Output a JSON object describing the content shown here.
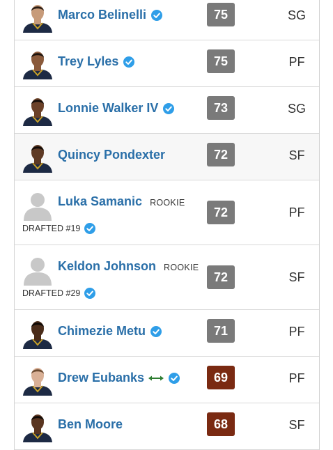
{
  "colors": {
    "name_link": "#2a6fa8",
    "rating_gray": "#7a7a7a",
    "rating_brown": "#7a2a12",
    "verified": "#2f9ee8",
    "trade_arrow": "#2e7d32"
  },
  "players": [
    {
      "name": "Marco Belinelli",
      "rating": "75",
      "position": "SG",
      "verified": true,
      "rookie": false,
      "skin": "#c79b7a",
      "hair": "#2b1d14"
    },
    {
      "name": "Trey Lyles",
      "rating": "75",
      "position": "PF",
      "verified": true,
      "rookie": false,
      "skin": "#8a5a3b",
      "hair": "#1c120c"
    },
    {
      "name": "Lonnie Walker IV",
      "rating": "73",
      "position": "SG",
      "verified": true,
      "rookie": false,
      "skin": "#6b4128",
      "hair": "#120c08"
    },
    {
      "name": "Quincy Pondexter",
      "rating": "72",
      "position": "SF",
      "verified": false,
      "rookie": false,
      "skin": "#5e3a24",
      "hair": "#100a06"
    },
    {
      "name": "Luka Samanic",
      "rating": "72",
      "position": "PF",
      "verified": false,
      "rookie": true,
      "rookie_label": "ROOKIE",
      "drafted": "DRAFTED #19"
    },
    {
      "name": "Keldon Johnson",
      "rating": "72",
      "position": "SF",
      "verified": false,
      "rookie": true,
      "rookie_label": "ROOKIE",
      "drafted": "DRAFTED #29"
    },
    {
      "name": "Chimezie Metu",
      "rating": "71",
      "position": "PF",
      "verified": true,
      "rookie": false,
      "skin": "#4a2c1a",
      "hair": "#0d0805"
    },
    {
      "name": "Drew Eubanks",
      "rating": "69",
      "position": "PF",
      "verified": true,
      "rookie": false,
      "trade": true,
      "skin": "#d9b096",
      "hair": "#6a4a30"
    },
    {
      "name": "Ben Moore",
      "rating": "68",
      "position": "SF",
      "verified": false,
      "rookie": false,
      "skin": "#5a3520",
      "hair": "#0f0905"
    }
  ]
}
